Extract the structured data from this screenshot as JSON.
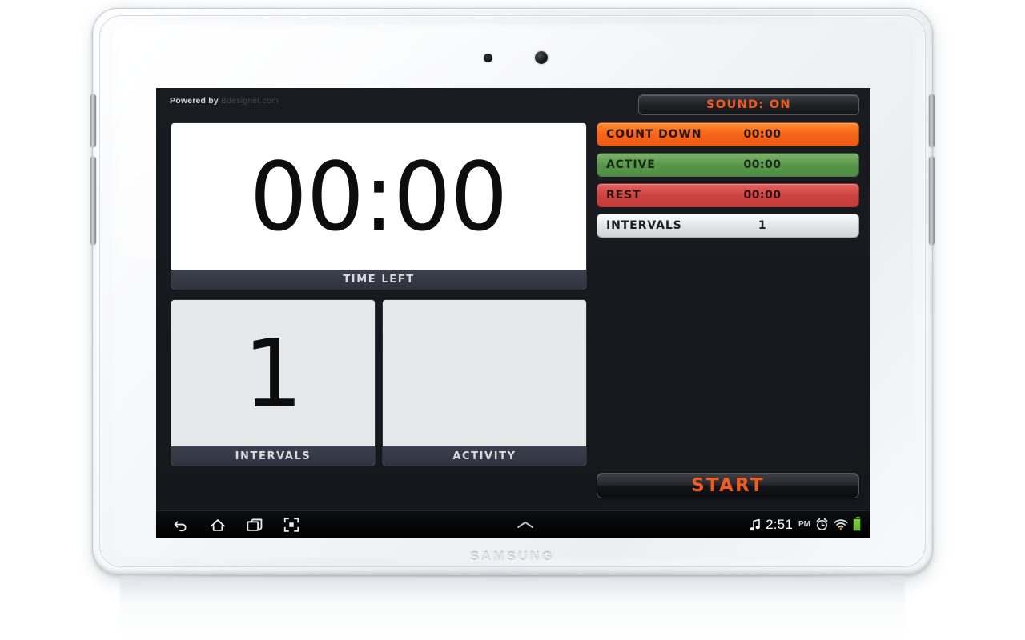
{
  "device": {
    "brand": "SAMSUNG",
    "camera_icon": "camera-lens",
    "sensor_icon": "proximity-sensor"
  },
  "app": {
    "credit_prefix": "Powered by",
    "credit_site": "Bdesignet.com",
    "timer": {
      "value": "00:00",
      "caption": "TIME LEFT"
    },
    "panels": [
      {
        "value": "1",
        "caption": "INTERVALS"
      },
      {
        "value": "",
        "caption": "ACTIVITY"
      }
    ],
    "sound_button": {
      "label": "SOUND: ON",
      "state": "ON"
    },
    "stats": [
      {
        "label": "COUNT DOWN",
        "value": "00:00",
        "color": "#f6631a"
      },
      {
        "label": "ACTIVE",
        "value": "00:00",
        "color": "#57964a"
      },
      {
        "label": "REST",
        "value": "00:00",
        "color": "#ce4340"
      },
      {
        "label": "INTERVALS",
        "value": "1",
        "color": "#e3e4e6"
      }
    ],
    "start_button": {
      "label": "START"
    }
  },
  "statusbar": {
    "nav_icons": [
      "back-icon",
      "home-icon",
      "recents-icon",
      "screenshot-icon"
    ],
    "expand_icon": "chevron-up-icon",
    "music_icon": "music-note-icon",
    "time": "2:51",
    "ampm": "PM",
    "alarm_icon": "alarm-clock-icon",
    "wifi_icon": "wifi-icon",
    "battery_icon": "battery-full-icon"
  },
  "colors": {
    "accent": "#ef5d22",
    "app_bg": "#17191e",
    "caption_bar": "#353845"
  }
}
